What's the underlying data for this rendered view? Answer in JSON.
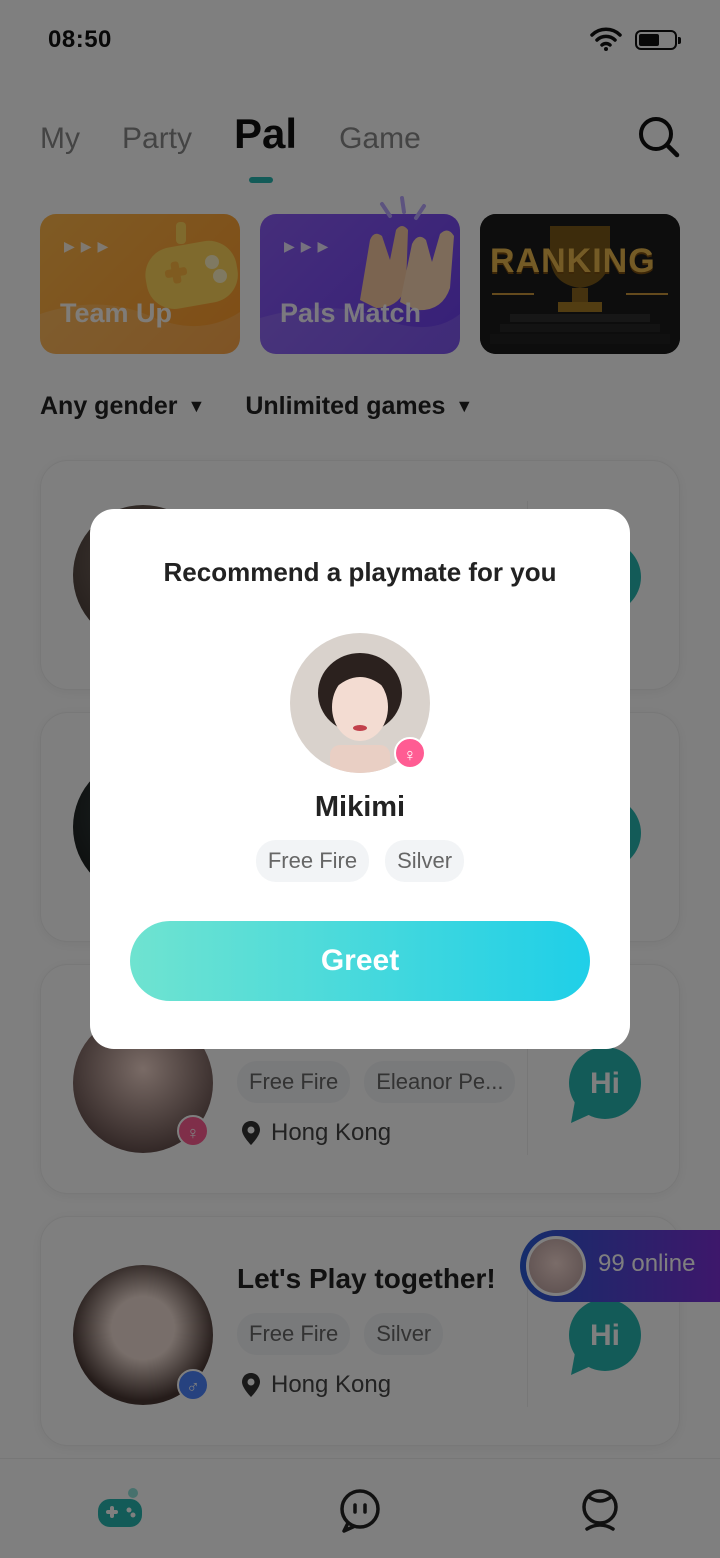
{
  "status_bar": {
    "time": "08:50"
  },
  "tabs": [
    {
      "label": "My",
      "active": false
    },
    {
      "label": "Party",
      "active": false
    },
    {
      "label": "Pal",
      "active": true
    },
    {
      "label": "Game",
      "active": false
    }
  ],
  "banners": [
    {
      "label": "Team Up",
      "icon": "gamepad-icon"
    },
    {
      "label": "Pals Match",
      "icon": "clapping-hands-icon"
    },
    {
      "label": "RANKING",
      "icon": "trophy-icon"
    }
  ],
  "filters": [
    {
      "label": "Any gender"
    },
    {
      "label": "Unlimited games"
    }
  ],
  "cards": [
    {
      "title": "",
      "tags": [
        "Free Fire",
        "Eleanor Pe..."
      ],
      "location": "Hong Kong",
      "gender": "female",
      "hi_label": "Hi"
    },
    {
      "title": "Let's Play together!",
      "tags": [
        "Free Fire",
        "Silver"
      ],
      "location": "Hong Kong",
      "gender": "male",
      "hi_label": "Hi"
    }
  ],
  "online": {
    "label": "99 online"
  },
  "bottom_nav": [
    {
      "icon": "gamepad-icon",
      "active": true
    },
    {
      "icon": "chat-icon",
      "active": false
    },
    {
      "icon": "profile-icon",
      "active": false
    }
  ],
  "modal": {
    "title": "Recommend a playmate for you",
    "name": "Mikimi",
    "gender": "female",
    "tags": [
      "Free Fire",
      "Silver"
    ],
    "greet_label": "Greet"
  },
  "colors": {
    "accent": "#27b7b0",
    "greet_start": "#6fe3d0",
    "greet_end": "#1fcfe8",
    "female": "#ff5c93",
    "male": "#4d84ff"
  }
}
